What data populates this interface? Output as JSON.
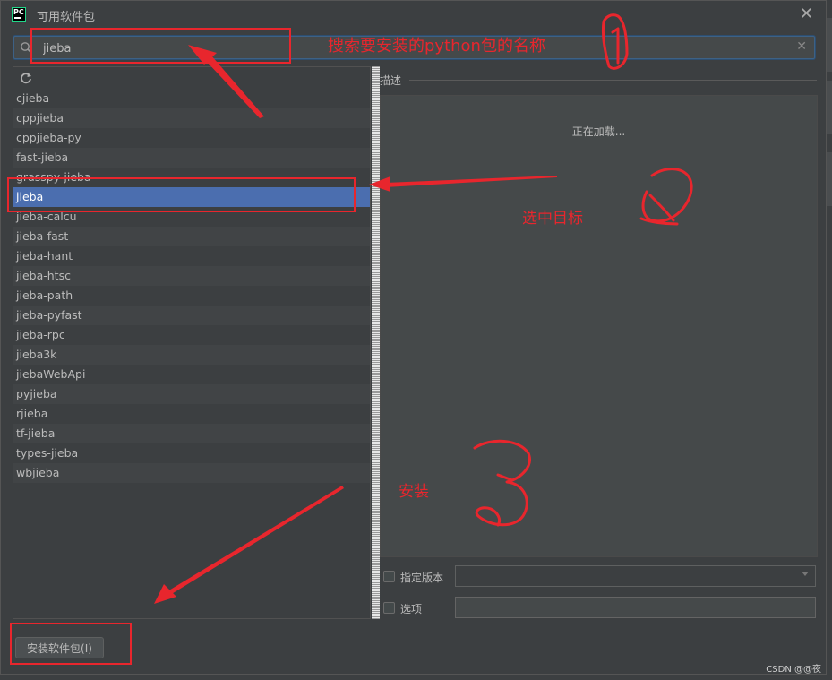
{
  "window": {
    "title": "可用软件包",
    "logo_text": "PC"
  },
  "search": {
    "value": "jieba"
  },
  "packages": [
    "cjieba",
    "cppjieba",
    "cppjieba-py",
    "fast-jieba",
    "grasspy-jieba",
    "jieba",
    "jieba-calcu",
    "jieba-fast",
    "jieba-hant",
    "jieba-htsc",
    "jieba-path",
    "jieba-pyfast",
    "jieba-rpc",
    "jieba3k",
    "jiebaWebApi",
    "pyjieba",
    "rjieba",
    "tf-jieba",
    "types-jieba",
    "wbjieba"
  ],
  "selected_package": "jieba",
  "description": {
    "label": "描述",
    "loading": "正在加载..."
  },
  "options": {
    "version_label": "指定版本",
    "options_label": "选项"
  },
  "install_button": "安装软件包(I)",
  "watermark": "CSDN @@夜",
  "annotations": {
    "search_note": "搜索要安装的python包的名称",
    "select_note": "选中目标",
    "install_note": "安装"
  },
  "colors": {
    "annotation": "#e8262d",
    "selection": "#4b6eaf"
  }
}
